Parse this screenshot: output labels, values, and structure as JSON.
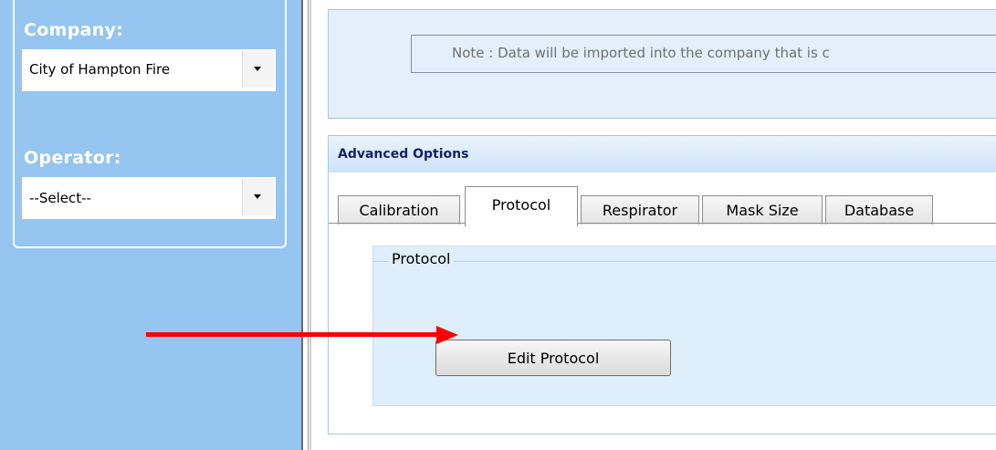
{
  "sidebar": {
    "company_label": "Company:",
    "company_value": "City of Hampton Fire",
    "operator_label": "Operator:",
    "operator_value": "--Select--"
  },
  "top_panel": {
    "note": "Note : Data will be imported into the company that is c"
  },
  "advanced_options": {
    "title": "Advanced Options",
    "tabs": [
      {
        "label": "Calibration"
      },
      {
        "label": "Protocol"
      },
      {
        "label": "Respirator"
      },
      {
        "label": "Mask Size"
      },
      {
        "label": "Database"
      }
    ],
    "active_tab": "Protocol",
    "group_title": "Protocol",
    "edit_button": "Edit Protocol"
  },
  "annotation": {
    "arrow_color": "#ff0000",
    "arrow_icon": "arrow-right-icon"
  }
}
